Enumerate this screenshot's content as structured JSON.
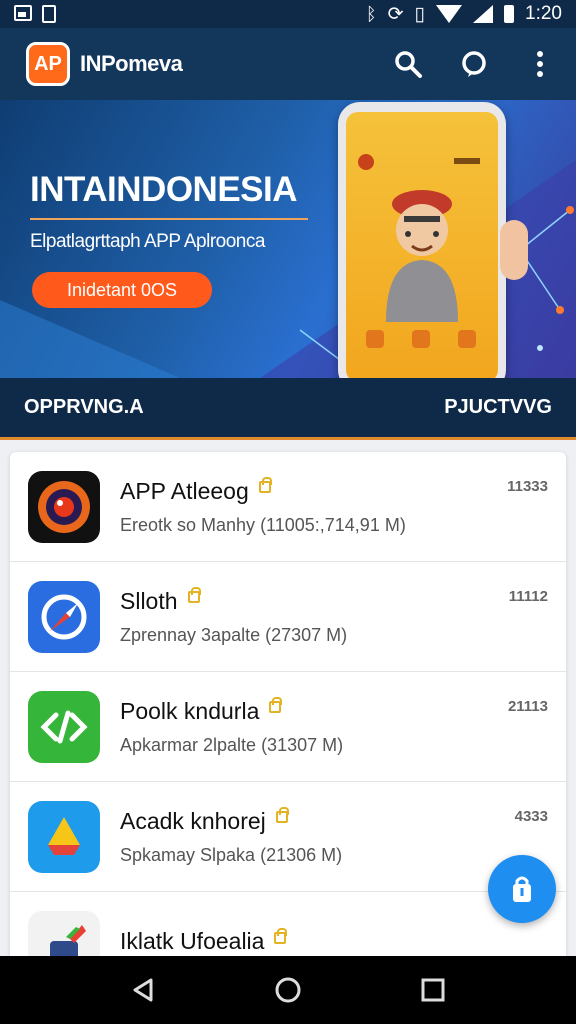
{
  "status_bar": {
    "time": "1:20"
  },
  "app_bar": {
    "logo_text": "AP",
    "title": "INPomeva"
  },
  "hero": {
    "title": "INTAINDONESIA",
    "subtitle": "Elpatlagrttaph APP Aplroonca",
    "cta_label": "Inidetant 0OS"
  },
  "band": {
    "left": "OPPRVNG.A",
    "right": "PJUCTVVG"
  },
  "apps": [
    {
      "name": "APP Atleeog",
      "meta": "Ereotk so Manhy (11005:,714,91 M)",
      "num": "11333",
      "icon_color": "#1b1b1b"
    },
    {
      "name": "Slloth",
      "meta": "Zprennay 3apalte (27307 M)",
      "num": "11112",
      "icon_color": "#2a6de0"
    },
    {
      "name": "Poolk kndurla",
      "meta": "Apkarmar 2lpalte (31307 M)",
      "num": "21113",
      "icon_color": "#35b63a"
    },
    {
      "name": "Acadk knhorej",
      "meta": "Spkamay Slpaka (21306 M)",
      "num": "4333",
      "icon_color": "#1e9bea"
    },
    {
      "name": "Iklatk Ufoealia",
      "meta": "",
      "num": "",
      "icon_color": "#f2f2f2"
    }
  ]
}
